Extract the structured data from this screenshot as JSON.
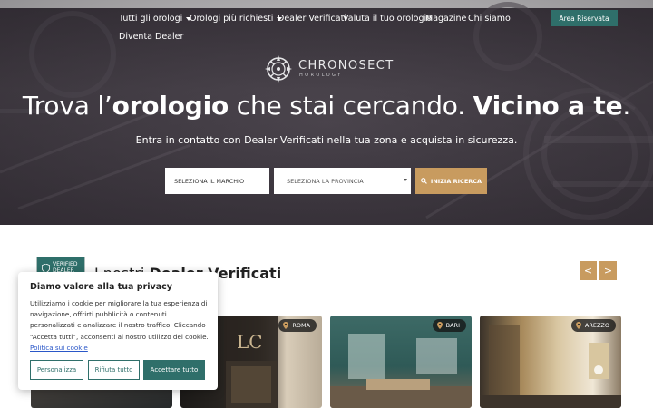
{
  "nav": {
    "items": [
      {
        "label": "Tutti gli orologi",
        "dropdown": true
      },
      {
        "label": "Orologi più richiesti",
        "dropdown": true
      },
      {
        "label": "Dealer Verificati",
        "dropdown": false
      },
      {
        "label": "Valuta il tuo orologio",
        "dropdown": false
      },
      {
        "label": "Magazine",
        "dropdown": false
      },
      {
        "label": "Chi siamo",
        "dropdown": false
      },
      {
        "label": "Diventa Dealer",
        "dropdown": false
      }
    ],
    "area_button": "Area Riservata"
  },
  "logo": {
    "title": "CHRONOSECT",
    "subtitle": "HOROLOGY"
  },
  "hero": {
    "headline_a": "Trova l’",
    "headline_b": "orologio",
    "headline_c": " che stai cercando. ",
    "headline_d": "Vicino a te",
    "headline_e": ".",
    "subline": "Entra in contatto con Dealer Verificati nella tua zona e acquista in sicurezza."
  },
  "search": {
    "brand_placeholder": "SELEZIONA IL MARCHIO",
    "province_placeholder": "SELEZIONA LA PROVINCIA",
    "button_label": "INIZIA RICERCA"
  },
  "dealers": {
    "badge_line1": "VERIFIED",
    "badge_line2": "DEALER",
    "title_a": "I nostri ",
    "title_b": "Dealer Verificati",
    "prev": "<",
    "next": ">",
    "cards": [
      {
        "city": ""
      },
      {
        "city": "ROMA"
      },
      {
        "city": "BARI"
      },
      {
        "city": "AREZZO"
      }
    ]
  },
  "cookie": {
    "title": "Diamo valore alla tua privacy",
    "text": "Utilizziamo i cookie per migliorare la tua esperienza di navigazione, offrirti pubblicità o contenuti personalizzati e analizzare il nostro traffico. Cliccando “Accetta tutti”, acconsenti al nostro utilizzo dei cookie.",
    "policy_link": "Politica sui cookie",
    "customize": "Personalizza",
    "reject": "Rifiuta tutto",
    "accept": "Accettare tutto"
  },
  "colors": {
    "teal": "#2f6f6a",
    "gold": "#c89b5f",
    "hero_bg": "#443e46"
  }
}
